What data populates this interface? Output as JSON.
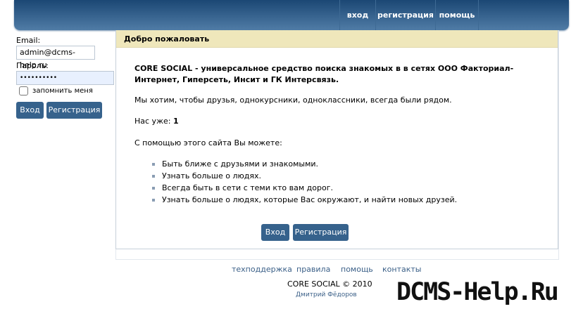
{
  "header": {
    "nav": [
      {
        "label": "вход"
      },
      {
        "label": "регистрация"
      },
      {
        "label": "помощь"
      }
    ]
  },
  "login": {
    "email_label": "Email:",
    "email_value": "admin@dcms-help.ru",
    "password_label": "Пароль:",
    "password_value": "••••••••••",
    "remember_label": "запомнить меня",
    "remember_checked": false,
    "login_button": "Вход",
    "register_button": "Регистрация"
  },
  "main": {
    "title": "Добро пожаловать",
    "intro": "CORE SOCIAL - универсальное средство поиска знакомых в в сетях ООО Факториал-Интернет, Гиперсеть, Инсит и ГК Интерсвязь.",
    "line1": "Мы хотим, чтобы друзья, однокурсники, одноклассники, всегда были рядом.",
    "count_label": "Нас уже:",
    "count_value": "1",
    "features_title": "С помощью этого сайта Вы можете:",
    "features": [
      "Быть ближе с друзьями и знакомыми.",
      "Узнать больше о людях.",
      "Всегда быть в сети с теми кто вам дорог.",
      "Узнать больше о людях, которые Вас окружают, и найти новых друзей."
    ],
    "login_button": "Вход",
    "register_button": "Регистрация"
  },
  "footer": {
    "links": [
      "техподдержка",
      "правила",
      "помощь",
      "контакты"
    ],
    "copyright": "CORE SOCIAL © 2010",
    "author": "Дмитрий Фёдоров"
  },
  "watermark": "DCMS-Help.Ru",
  "colors": {
    "header": "#1b4774",
    "button": "#36628c",
    "panel_title_bg": "#efe7bb"
  }
}
